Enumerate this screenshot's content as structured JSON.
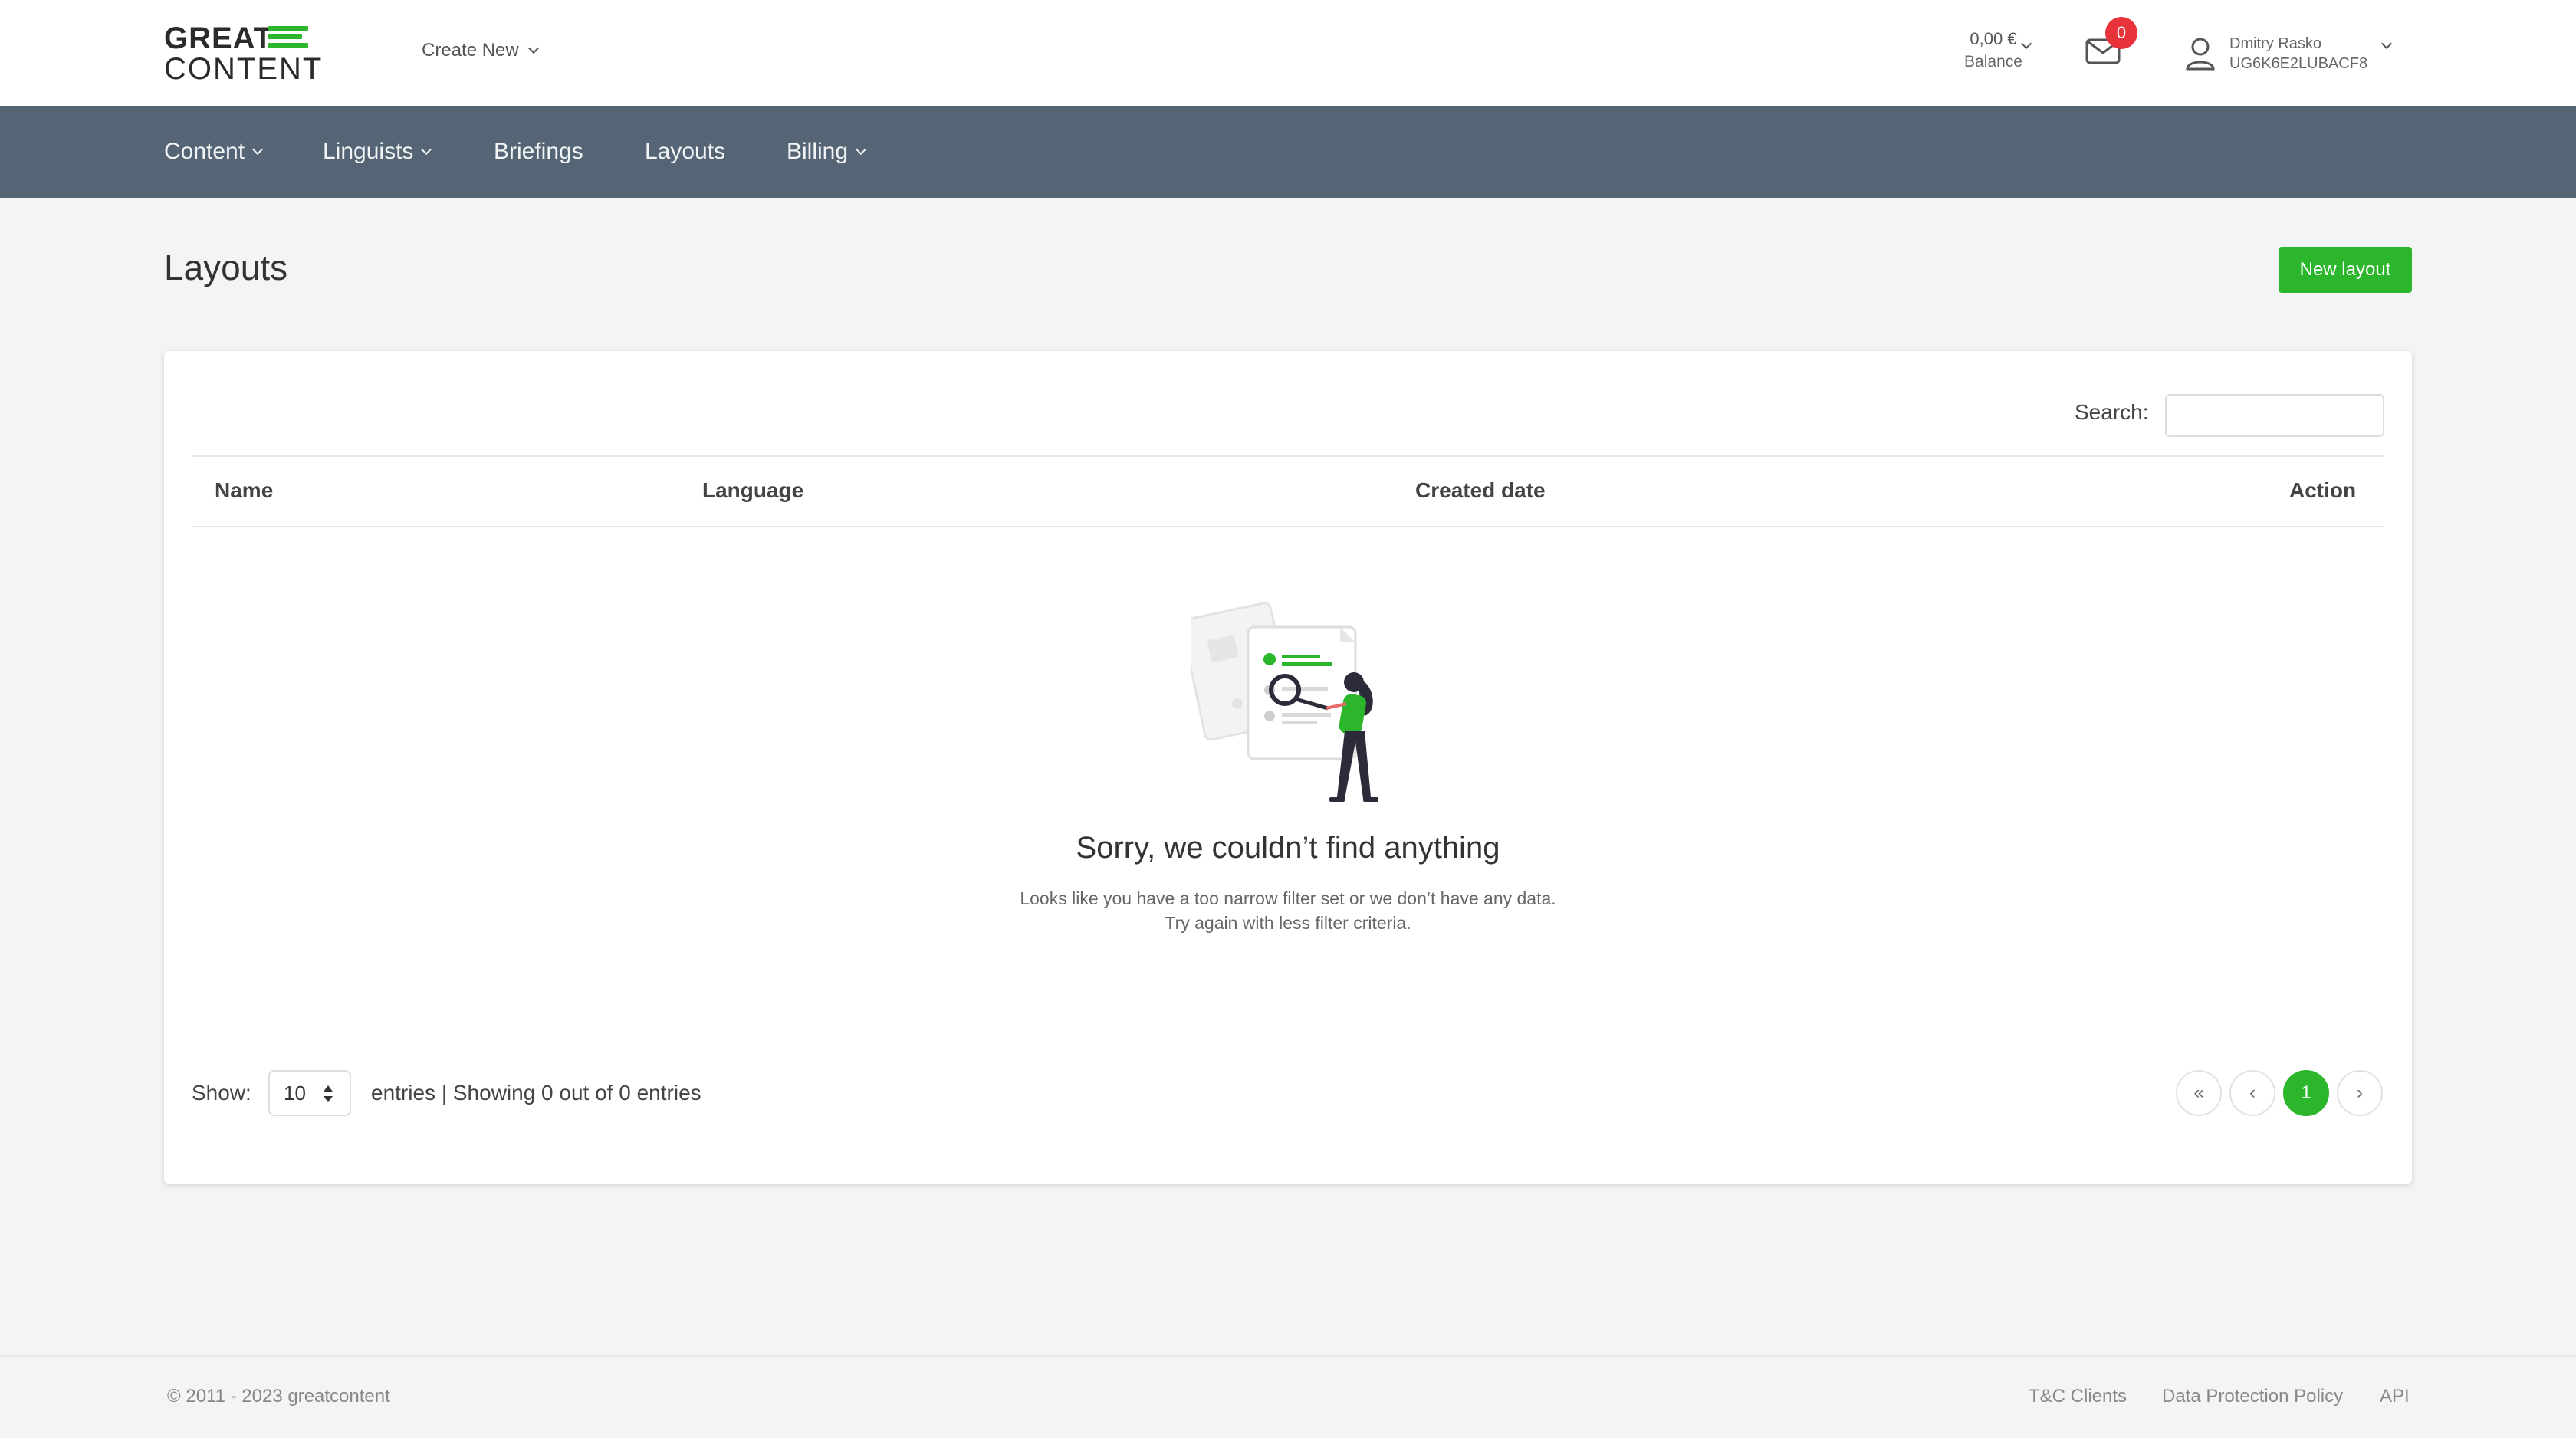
{
  "header": {
    "logo_top": "GREAT",
    "logo_bottom": "CONTENT",
    "create_new": "Create New",
    "balance_amount": "0,00 €",
    "balance_label": "Balance",
    "mail_count": "0",
    "user_name": "Dmitry Rasko",
    "user_id": "UG6K6E2LUBACF8"
  },
  "nav": {
    "items": [
      {
        "label": "Content",
        "dropdown": true
      },
      {
        "label": "Linguists",
        "dropdown": true
      },
      {
        "label": "Briefings",
        "dropdown": false
      },
      {
        "label": "Layouts",
        "dropdown": false
      },
      {
        "label": "Billing",
        "dropdown": true
      }
    ]
  },
  "page": {
    "title": "Layouts",
    "new_button": "New layout"
  },
  "table": {
    "search_label": "Search:",
    "search_value": "",
    "columns": [
      "Name",
      "Language",
      "Created date",
      "Action"
    ],
    "rows": []
  },
  "empty": {
    "title": "Sorry, we couldn’t find anything",
    "line1": "Looks like you have a too narrow filter set or we don’t have any data.",
    "line2": "Try again with less filter criteria."
  },
  "footer_controls": {
    "show_label": "Show:",
    "page_size": "10",
    "entries_text": "entries |  Showing 0 out of 0 entries",
    "pager": {
      "first": "«",
      "prev": "‹",
      "current": "1",
      "next": "›"
    }
  },
  "footer": {
    "copyright": "© 2011 - 2023 greatcontent",
    "links": [
      "T&C Clients",
      "Data Protection Policy",
      "API"
    ]
  },
  "colors": {
    "accent": "#2bb62c",
    "navbar": "#566575",
    "badge": "#e8333a"
  }
}
